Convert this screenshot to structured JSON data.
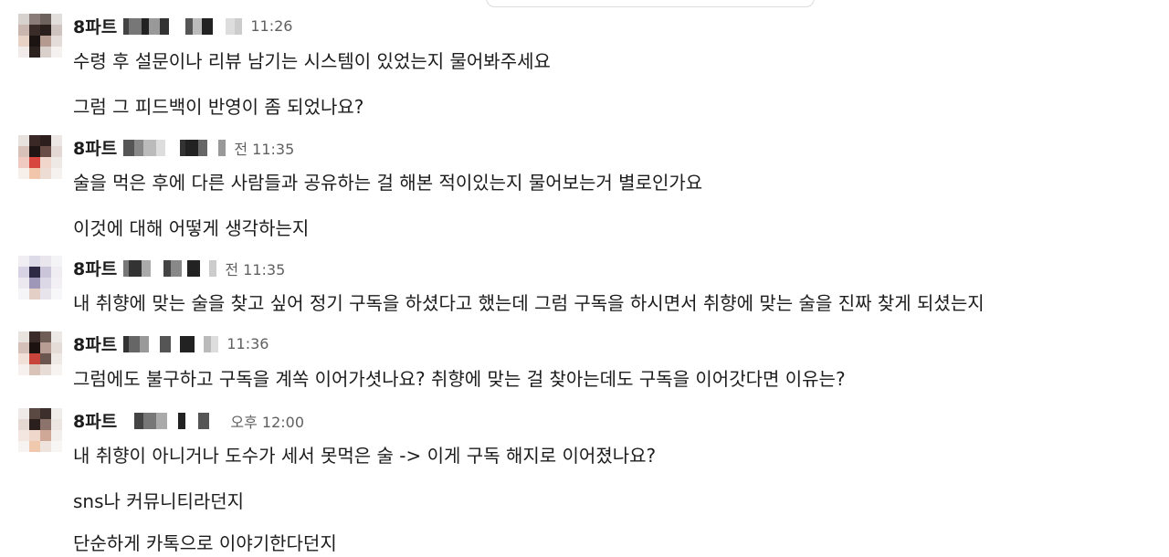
{
  "messages": [
    {
      "sender": "8파트",
      "time": "11:26",
      "lines": [
        "수령 후 설문이나 리뷰 남기는 시스템이 있었는지 물어봐주세요",
        "그럼 그 피드백이 반영이 좀 되었나요?"
      ]
    },
    {
      "sender": "8파트",
      "time": "전 11:35",
      "lines": [
        "술을 먹은 후에 다른 사람들과 공유하는 걸 해본 적이있는지 물어보는거 별로인가요",
        "이것에 대해 어떻게 생각하는지"
      ]
    },
    {
      "sender": "8파트",
      "time": "전 11:35",
      "lines": [
        "내 취향에 맞는 술을 찾고 싶어 정기 구독을 하셨다고 했는데 그럼 구독을 하시면서 취향에 맞는 술을 진짜 찾게 되셨는지"
      ]
    },
    {
      "sender": "8파트",
      "time": "11:36",
      "lines": [
        "그럼에도 불구하고 구독을 계쏙 이어가셧나요? 취향에 맞는 걸 찾아는데도 구독을 이어갓다면 이유는?"
      ]
    },
    {
      "sender": "8파트",
      "time": "오후 12:00",
      "lines": [
        "내 취향이 아니거나 도수가 세서 못먹은 술 -> 이게 구독 해지로 이어졌나요?",
        "sns나 커뮤니티라던지",
        "단순하게 카톡으로 이야기한다던지"
      ]
    }
  ],
  "colors": {
    "text": "#1d1c1d",
    "timestamp": "#616061",
    "background": "#ffffff"
  }
}
